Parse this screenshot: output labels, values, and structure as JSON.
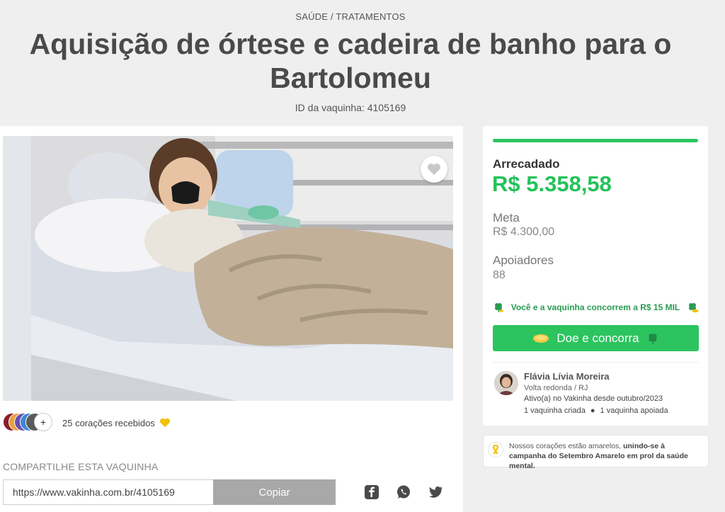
{
  "header": {
    "category": "SAÚDE / TRATAMENTOS",
    "title": "Aquisição de órtese e cadeira de banho para o Bartolomeu",
    "id_line": "ID da vaquinha: 4105169"
  },
  "hearts": {
    "plus": "+",
    "text": "25 corações recebidos",
    "avatar_colors": [
      "#8b1d2c",
      "#e8a13b",
      "#6a4fb3",
      "#3f86d6",
      "#5b5b5b"
    ]
  },
  "share": {
    "label": "COMPARTILHE ESTA VAQUINHA",
    "url": "https://www.vakinha.com.br/4105169",
    "copy_label": "Copiar",
    "icons": [
      "facebook-icon",
      "whatsapp-icon",
      "twitter-icon"
    ]
  },
  "stats": {
    "raised_label": "Arrecadado",
    "raised_value": "R$ 5.358,58",
    "goal_label": "Meta",
    "goal_value": "R$ 4.300,00",
    "supporters_label": "Apoiadores",
    "supporters_value": "88",
    "progress": 1.0,
    "promo_text": "Você e a vaquinha concorrem a R$ 15 MIL",
    "donate_label": "Doe e concorra"
  },
  "creator": {
    "name": "Flávia Lívia Moreira",
    "city": "Volta redonda / RJ",
    "active": "Ativo(a) no Vakinha desde outubro/2023",
    "created": "1 vaquinha criada",
    "supported": "1 vaquinha apoiada"
  },
  "notice": {
    "text_a": "Nossos corações estão amarelos, ",
    "text_b": "unindo-se à campanha do Setembro Amarelo em prol da saúde mental."
  },
  "colors": {
    "accent_green": "#2cc45f",
    "heart_yellow": "#f2c000",
    "copy_gray": "#a8a8a8"
  }
}
